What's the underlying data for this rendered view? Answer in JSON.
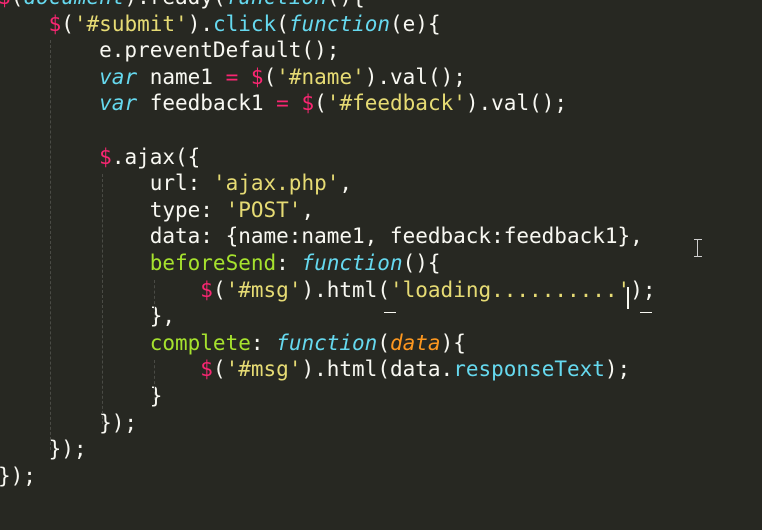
{
  "editor": {
    "lines": [
      [
        [
          "$",
          "tok-dollar"
        ],
        [
          "(",
          "tok-plain"
        ],
        [
          "document",
          "tok-kw"
        ],
        [
          ").ready(",
          "tok-plain"
        ],
        [
          "function",
          "tok-kw"
        ],
        [
          "(){",
          "tok-plain"
        ]
      ],
      [
        [
          "    ",
          "tok-plain"
        ],
        [
          "$",
          "tok-dollar"
        ],
        [
          "(",
          "tok-plain"
        ],
        [
          "'#submit'",
          "tok-str"
        ],
        [
          ").",
          "tok-plain"
        ],
        [
          "click",
          "tok-attr"
        ],
        [
          "(",
          "tok-plain"
        ],
        [
          "function",
          "tok-kw"
        ],
        [
          "(e){",
          "tok-plain"
        ]
      ],
      [
        [
          "        e.preventDefault();",
          "tok-plain"
        ]
      ],
      [
        [
          "        ",
          "tok-plain"
        ],
        [
          "var",
          "tok-kw"
        ],
        [
          " name1 ",
          "tok-plain"
        ],
        [
          "=",
          "tok-op"
        ],
        [
          " ",
          "tok-plain"
        ],
        [
          "$",
          "tok-dollar"
        ],
        [
          "(",
          "tok-plain"
        ],
        [
          "'#name'",
          "tok-str"
        ],
        [
          ").val();",
          "tok-plain"
        ]
      ],
      [
        [
          "        ",
          "tok-plain"
        ],
        [
          "var",
          "tok-kw"
        ],
        [
          " feedback1 ",
          "tok-plain"
        ],
        [
          "=",
          "tok-op"
        ],
        [
          " ",
          "tok-plain"
        ],
        [
          "$",
          "tok-dollar"
        ],
        [
          "(",
          "tok-plain"
        ],
        [
          "'#feedback'",
          "tok-str"
        ],
        [
          ").val();",
          "tok-plain"
        ]
      ],
      [
        [
          "",
          "tok-plain"
        ]
      ],
      [
        [
          "        ",
          "tok-plain"
        ],
        [
          "$",
          "tok-dollar"
        ],
        [
          ".ajax({",
          "tok-plain"
        ]
      ],
      [
        [
          "            url: ",
          "tok-plain"
        ],
        [
          "'ajax.php'",
          "tok-str"
        ],
        [
          ",",
          "tok-plain"
        ]
      ],
      [
        [
          "            type: ",
          "tok-plain"
        ],
        [
          "'POST'",
          "tok-str"
        ],
        [
          ",",
          "tok-plain"
        ]
      ],
      [
        [
          "            data: {name:name1, feedback:feedback1},",
          "tok-plain"
        ]
      ],
      [
        [
          "            ",
          "tok-plain"
        ],
        [
          "beforeSend",
          "tok-key"
        ],
        [
          ": ",
          "tok-plain"
        ],
        [
          "function",
          "tok-kw"
        ],
        [
          "(){",
          "tok-plain"
        ]
      ],
      [
        [
          "                ",
          "tok-plain"
        ],
        [
          "$",
          "tok-dollar"
        ],
        [
          "(",
          "tok-plain"
        ],
        [
          "'#msg'",
          "tok-str"
        ],
        [
          ").html(",
          "tok-plain"
        ],
        [
          "'loading..........'",
          "tok-str"
        ],
        [
          ");",
          "tok-plain"
        ]
      ],
      [
        [
          "            },",
          "tok-plain"
        ]
      ],
      [
        [
          "            ",
          "tok-plain"
        ],
        [
          "complete",
          "tok-key"
        ],
        [
          ": ",
          "tok-plain"
        ],
        [
          "function",
          "tok-kw"
        ],
        [
          "(",
          "tok-plain"
        ],
        [
          "data",
          "tok-param"
        ],
        [
          "){",
          "tok-plain"
        ]
      ],
      [
        [
          "                ",
          "tok-plain"
        ],
        [
          "$",
          "tok-dollar"
        ],
        [
          "(",
          "tok-plain"
        ],
        [
          "'#msg'",
          "tok-str"
        ],
        [
          ").html(data.",
          "tok-plain"
        ],
        [
          "responseText",
          "tok-attr"
        ],
        [
          ");",
          "tok-plain"
        ]
      ],
      [
        [
          "            }",
          "tok-plain"
        ]
      ],
      [
        [
          "        });",
          "tok-plain"
        ]
      ],
      [
        [
          "    });",
          "tok-plain"
        ]
      ],
      [
        [
          "});",
          "tok-plain"
        ]
      ]
    ],
    "theme": {
      "background": "#272822",
      "foreground": "#f8f8f2",
      "dollar": "#f92672",
      "string": "#e6db74",
      "keyword": "#66d9ef",
      "param": "#fd971f",
      "key": "#a6e22e"
    }
  }
}
